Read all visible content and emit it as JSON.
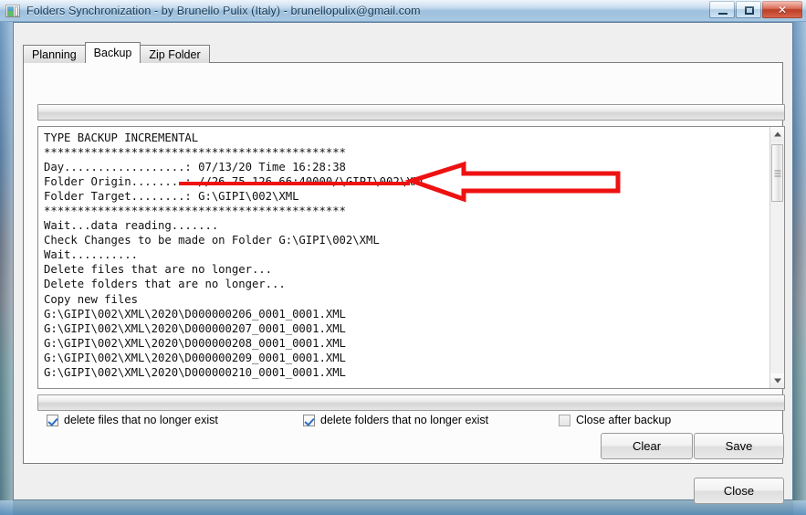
{
  "window": {
    "title": "Folders Synchronization - by Brunello Pulix (Italy) - brunellopulix@gmail.com",
    "icon": "app-window-icon",
    "controls": {
      "minimize": "minimize",
      "maximize": "maximize",
      "close": "✕"
    }
  },
  "tabs": [
    {
      "label": "Planning",
      "active": false
    },
    {
      "label": "Backup",
      "active": true
    },
    {
      "label": "Zip Folder",
      "active": false
    }
  ],
  "log": {
    "text": "TYPE BACKUP INCREMENTAL\n*********************************************\nDay..................: 07/13/20 Time 16:28:38\nFolder Origin........: //26.75.126.66:40000/\\GIPI\\002\\XML\nFolder Target........: G:\\GIPI\\002\\XML\n*********************************************\nWait...data reading.......\nCheck Changes to be made on Folder G:\\GIPI\\002\\XML\nWait..........\nDelete files that are no longer...\nDelete folders that are no longer...\nCopy new files\nG:\\GIPI\\002\\XML\\2020\\D000000206_0001_0001.XML\nG:\\GIPI\\002\\XML\\2020\\D000000207_0001_0001.XML\nG:\\GIPI\\002\\XML\\2020\\D000000208_0001_0001.XML\nG:\\GIPI\\002\\XML\\2020\\D000000209_0001_0001.XML\nG:\\GIPI\\002\\XML\\2020\\D000000210_0001_0001.XML",
    "lines": [
      "TYPE BACKUP INCREMENTAL",
      "*********************************************",
      "Day..................: 07/13/20 Time 16:28:38",
      "Folder Origin........: //26.75.126.66:40000/\\GIPI\\002\\XML",
      "Folder Target........: G:\\GIPI\\002\\XML",
      "*********************************************",
      "Wait...data reading.......",
      "Check Changes to be made on Folder G:\\GIPI\\002\\XML",
      "Wait..........",
      "Delete files that are no longer...",
      "Delete folders that are no longer...",
      "Copy new files",
      "G:\\GIPI\\002\\XML\\2020\\D000000206_0001_0001.XML",
      "G:\\GIPI\\002\\XML\\2020\\D000000207_0001_0001.XML",
      "G:\\GIPI\\002\\XML\\2020\\D000000208_0001_0001.XML",
      "G:\\GIPI\\002\\XML\\2020\\D000000209_0001_0001.XML",
      "G:\\GIPI\\002\\XML\\2020\\D000000210_0001_0001.XML"
    ],
    "backup_type": "INCREMENTAL",
    "day": "07/13/20",
    "time": "16:28:38",
    "folder_origin": "//26.75.126.66:40000/\\GIPI\\002\\XML",
    "folder_target": "G:\\GIPI\\002\\XML"
  },
  "scrollbar": {
    "up_arrow": "scroll-up",
    "down_arrow": "scroll-down"
  },
  "progress": {
    "top_value": 0,
    "bottom_value": 0
  },
  "checkboxes": [
    {
      "label": "delete files that no longer exist",
      "checked": true
    },
    {
      "label": "delete folders that no longer exist",
      "checked": true
    },
    {
      "label": "Close after backup",
      "checked": false
    }
  ],
  "buttons": {
    "clear": "Clear",
    "save": "Save",
    "close": "Close"
  },
  "annotation": {
    "color": "#ee1111",
    "underline_target": "folder-origin-path",
    "arrow_direction": "left",
    "style": "hollow-outline"
  }
}
